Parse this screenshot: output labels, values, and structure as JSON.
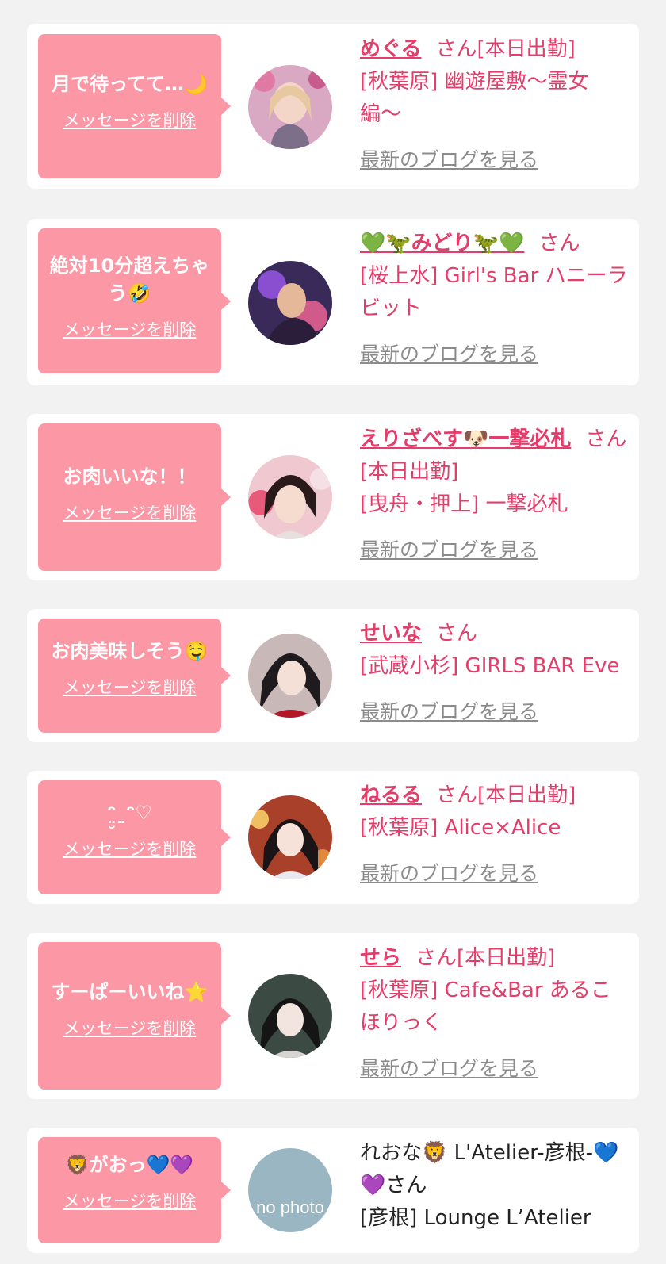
{
  "delete_label": "メッセージを削除",
  "blog_label": "最新のブログを見る",
  "san_label": "さん",
  "messages": [
    {
      "bubble": "月で待ってて…🌙",
      "name": "めぐる",
      "suffix": "さん[本日出勤]",
      "shop": "[秋葉原] 幽遊屋敷〜霊女編〜",
      "blog": "最新のブログを見る"
    },
    {
      "bubble": "絶対10分超えちゃう🤣",
      "name": "💚🦖みどり🦖💚",
      "suffix": "さん",
      "shop": "[桜上水] Girl's Bar ハニーラビット",
      "blog": "最新のブログを見る"
    },
    {
      "bubble": "お肉いいな！！",
      "name": "えりざべす🐶一撃必札",
      "suffix": "さん[本日出勤]",
      "shop": "[曳舟・押上] 一撃必札",
      "blog": "最新のブログを見る"
    },
    {
      "bubble": "お肉美味しそう🤤",
      "name": "せいな",
      "suffix": "さん",
      "shop": "[武蔵小杉] GIRLS BAR Eve",
      "blog": "最新のブログを見る"
    },
    {
      "bubble": "ᵔ̤̮˷̤ᵔ♡",
      "name": "ねるる",
      "suffix": "さん[本日出勤]",
      "shop": "[秋葉原] Alice×Alice",
      "blog": "最新のブログを見る"
    },
    {
      "bubble": "すーぱーいいね⭐",
      "name": "せら",
      "suffix": "さん[本日出勤]",
      "shop": "[秋葉原] Cafe&Bar あるこほりっく",
      "blog": "最新のブログを見る"
    },
    {
      "bubble": "🦁がおっ💙💜",
      "name": "れおな🦁 L'Atelier-彦根-💙💜さん",
      "suffix": "",
      "shop": "[彦根] Lounge L’Atelier",
      "avatar_text": "no photo"
    }
  ],
  "colors": {
    "background": "#f2f2f2",
    "bubble": "#fc97a6",
    "accent": "#e43d6a",
    "muted": "#8c8c8c"
  }
}
